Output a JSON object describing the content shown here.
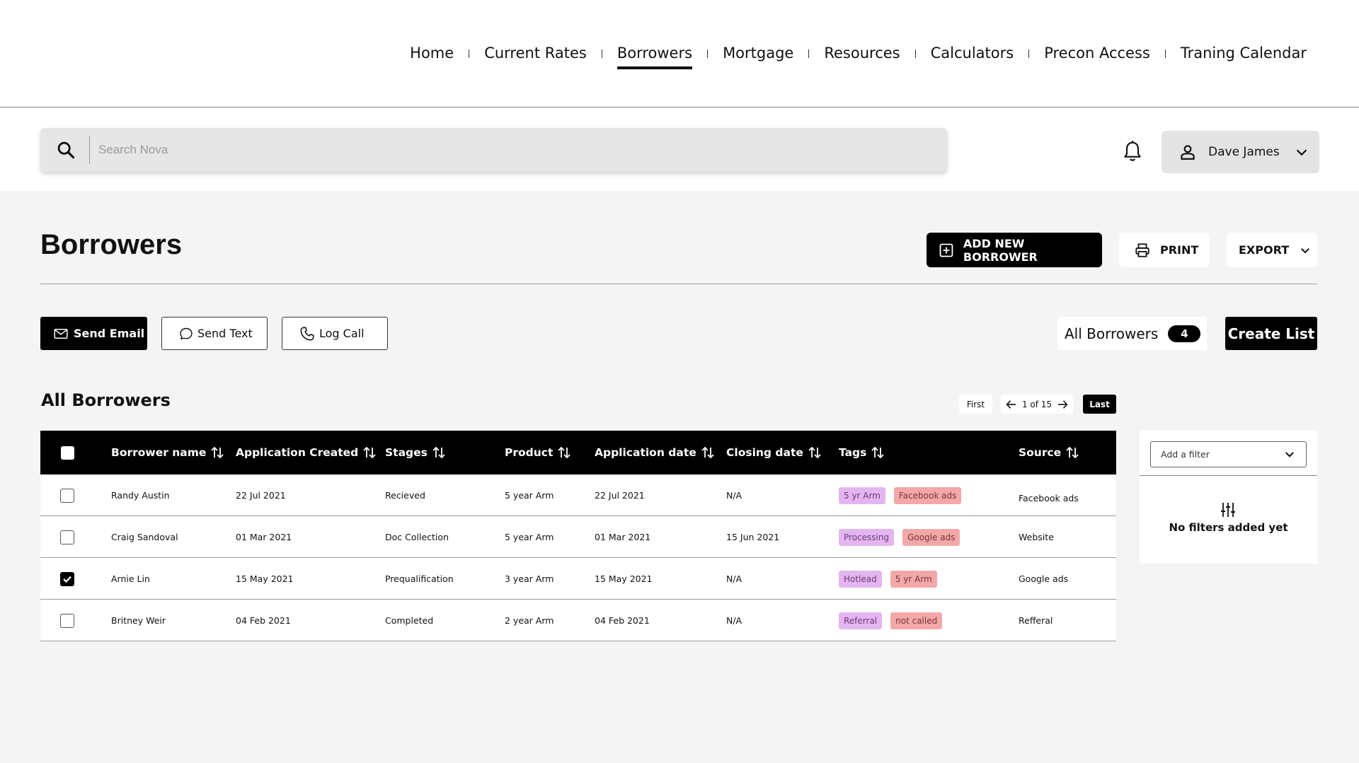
{
  "nav": {
    "items": [
      {
        "label": "Home",
        "active": false
      },
      {
        "label": "Current Rates",
        "active": false
      },
      {
        "label": "Borrowers",
        "active": true
      },
      {
        "label": "Mortgage",
        "active": false
      },
      {
        "label": "Resources",
        "active": false
      },
      {
        "label": "Calculators",
        "active": false
      },
      {
        "label": "Precon Access",
        "active": false
      },
      {
        "label": "Traning Calendar",
        "active": false
      }
    ]
  },
  "search": {
    "placeholder": "Search Nova",
    "value": ""
  },
  "user": {
    "name": "Dave James"
  },
  "page": {
    "title": "Borrowers",
    "add_label": "ADD NEW BORROWER",
    "print_label": "PRINT",
    "export_label": "EXPORT"
  },
  "actions": {
    "send_email": "Send Email",
    "send_text": "Send Text",
    "log_call": "Log Call",
    "list_name": "All Borrowers",
    "list_count": "4",
    "create_list": "Create List"
  },
  "table": {
    "title": "All Borrowers",
    "pager": {
      "first": "First",
      "page_text": "1 of 15",
      "last": "Last"
    },
    "columns": [
      "Borrower name",
      "Application Created",
      "Stages",
      "Product",
      "Application date",
      "Closing date",
      "Tags",
      "Source"
    ],
    "rows": [
      {
        "checked": false,
        "name": "Randy Austin",
        "created": "22 Jul 2021",
        "stage": "Recieved",
        "product": "5 year Arm",
        "app_date": "22 Jul 2021",
        "closing": "N/A",
        "tags": [
          {
            "label": "5 yr Arm",
            "color": "#e4b5f0"
          },
          {
            "label": "Facebook ads",
            "color": "#f3a8a8"
          }
        ],
        "source": "Facebook ads"
      },
      {
        "checked": false,
        "name": "Craig Sandoval",
        "created": "01 Mar 2021",
        "stage": "Doc Collection",
        "product": "5 year Arm",
        "app_date": "01 Mar 2021",
        "closing": "15 Jun 2021",
        "tags": [
          {
            "label": "Processing",
            "color": "#e4b5f0"
          },
          {
            "label": "Google ads",
            "color": "#f3a8a8"
          }
        ],
        "source": "Website"
      },
      {
        "checked": true,
        "name": "Arnie Lin",
        "created": "15 May 2021",
        "stage": "Prequalification",
        "product": "3 year Arm",
        "app_date": "15 May 2021",
        "closing": "N/A",
        "tags": [
          {
            "label": "Hotlead",
            "color": "#e4b5f0"
          },
          {
            "label": "5 yr Arm",
            "color": "#f3a8a8"
          }
        ],
        "source": "Google ads"
      },
      {
        "checked": false,
        "name": "Britney Weir",
        "created": "04 Feb 2021",
        "stage": "Completed",
        "product": "2 year Arm",
        "app_date": "04 Feb 2021",
        "closing": "N/A",
        "tags": [
          {
            "label": "Referral",
            "color": "#e4b5f0"
          },
          {
            "label": "not called",
            "color": "#f3a8a8"
          }
        ],
        "source": "Refferal"
      }
    ]
  },
  "filters": {
    "select_placeholder": "Add a filter",
    "empty_text": "No filters added yet"
  },
  "icons": {
    "search": "search-icon",
    "bell": "bell-icon",
    "user": "user-icon",
    "chevron": "chevron-down-icon",
    "add": "plus-square-icon",
    "print": "printer-icon",
    "email": "mail-icon",
    "text": "chat-bubble-icon",
    "call": "phone-icon",
    "sort": "sort-icon",
    "filter": "sliders-icon"
  },
  "colors": {
    "accent": "#000000",
    "tag_purple": "#e4b5f0",
    "tag_red": "#f3a8a8",
    "background": "#f4f4f4"
  }
}
